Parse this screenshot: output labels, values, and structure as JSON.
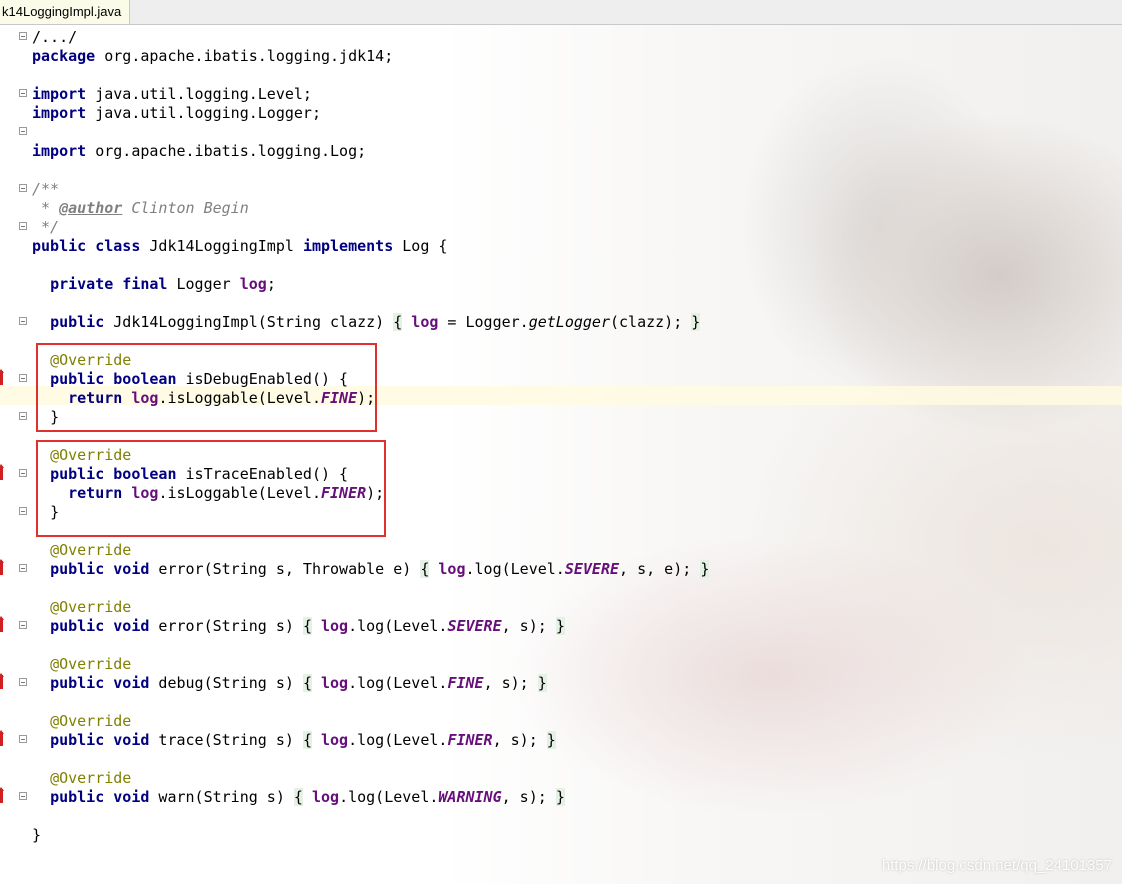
{
  "tab": {
    "label": "k14LoggingImpl.java"
  },
  "code": {
    "l1": "/.../",
    "l2_kw": "package",
    "l2_rest": " org.apache.ibatis.logging.jdk14;",
    "l4_kw": "import",
    "l4_rest": " java.util.logging.Level;",
    "l5_kw": "import",
    "l5_rest": " java.util.logging.Logger;",
    "l7_kw": "import",
    "l7_rest": " org.apache.ibatis.logging.Log;",
    "l9": "/**",
    "l10_a": " * ",
    "l10_tag": "@author",
    "l10_b": " Clinton Begin",
    "l11": " */",
    "l12_kw1": "public class",
    "l12_name": " Jdk14LoggingImpl ",
    "l12_kw2": "implements",
    "l12_rest": " Log {",
    "l14_kw": "private final",
    "l14_type": " Logger ",
    "l14_fld": "log",
    "l14_end": ";",
    "l16_kw": "public",
    "l16_a": " Jdk14LoggingImpl(String clazz) ",
    "l16_ob": "{",
    "l16_sp": " ",
    "l16_fld": "log",
    "l16_b": " = Logger.",
    "l16_m": "getLogger",
    "l16_c": "(clazz); ",
    "l16_cb": "}",
    "override": "@Override",
    "l19_kw": "public boolean",
    "l19_rest": " isDebugEnabled() {",
    "l20_kw": "return",
    "l20_sp": " ",
    "l20_fld": "log",
    "l20_a": ".isLoggable(Level.",
    "l20_c": "FINE",
    "l20_b": ");",
    "close": "}",
    "l24_kw": "public boolean",
    "l24_rest": " isTraceEnabled() {",
    "l25_kw": "return",
    "l25_sp": " ",
    "l25_fld": "log",
    "l25_a": ".isLoggable(Level.",
    "l25_c": "FINER",
    "l25_b": ");",
    "l29_kw": "public void",
    "l29_a": " error(String s, Throwable e) ",
    "l29_ob": "{",
    "l29_sp": " ",
    "l29_fld": "log",
    "l29_b": ".log(Level.",
    "l29_c": "SEVERE",
    "l29_d": ", s, e); ",
    "l29_cb": "}",
    "l32_kw": "public void",
    "l32_a": " error(String s) ",
    "l32_ob": "{",
    "l32_sp": " ",
    "l32_fld": "log",
    "l32_b": ".log(Level.",
    "l32_c": "SEVERE",
    "l32_d": ", s); ",
    "l32_cb": "}",
    "l35_kw": "public void",
    "l35_a": " debug(String s) ",
    "l35_ob": "{",
    "l35_sp": " ",
    "l35_fld": "log",
    "l35_b": ".log(Level.",
    "l35_c": "FINE",
    "l35_d": ", s); ",
    "l35_cb": "}",
    "l38_kw": "public void",
    "l38_a": " trace(String s) ",
    "l38_ob": "{",
    "l38_sp": " ",
    "l38_fld": "log",
    "l38_b": ".log(Level.",
    "l38_c": "FINER",
    "l38_d": ", s); ",
    "l38_cb": "}",
    "l41_kw": "public void",
    "l41_a": " warn(String s) ",
    "l41_ob": "{",
    "l41_sp": " ",
    "l41_fld": "log",
    "l41_b": ".log(Level.",
    "l41_c": "WARNING",
    "l41_d": ", s); ",
    "l41_cb": "}",
    "l43": "}"
  },
  "watermark": "https://blog.csdn.net/qq_24101357",
  "colors": {
    "keyword": "#000080",
    "annotation": "#808000",
    "field": "#660e7a",
    "highlight_box": "#e0302e"
  }
}
